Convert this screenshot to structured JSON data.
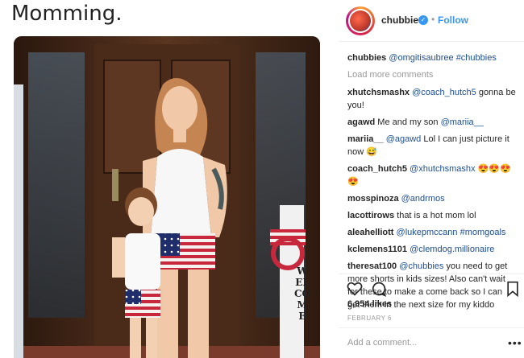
{
  "page": {
    "heading": "Momming."
  },
  "post": {
    "username": "chubbies",
    "follow_label": "Follow",
    "dot": "•",
    "load_more": "Load more comments",
    "comments": [
      {
        "user": "chubbies",
        "parts": [
          {
            "t": "mention",
            "v": "@omgitisaubree"
          },
          {
            "t": "text",
            "v": " "
          },
          {
            "t": "mention",
            "v": "#chubbies"
          }
        ]
      },
      {
        "user": "xhutchsmashx",
        "parts": [
          {
            "t": "mention",
            "v": "@coach_hutch5"
          },
          {
            "t": "text",
            "v": " gonna be you!"
          }
        ]
      },
      {
        "user": "agawd",
        "parts": [
          {
            "t": "text",
            "v": "Me and my son "
          },
          {
            "t": "mention",
            "v": "@mariia__"
          }
        ]
      },
      {
        "user": "mariia__",
        "parts": [
          {
            "t": "mention",
            "v": "@agawd"
          },
          {
            "t": "text",
            "v": " Lol I can just picture it now 😅"
          }
        ]
      },
      {
        "user": "coach_hutch5",
        "parts": [
          {
            "t": "mention",
            "v": "@xhutchsmashx"
          },
          {
            "t": "text",
            "v": " 😍😍😍😍"
          }
        ]
      },
      {
        "user": "mosspinoza",
        "parts": [
          {
            "t": "mention",
            "v": "@andrmos"
          }
        ]
      },
      {
        "user": "lacottirows",
        "parts": [
          {
            "t": "text",
            "v": "that is a hot mom lol"
          }
        ]
      },
      {
        "user": "aleahelliott",
        "parts": [
          {
            "t": "mention",
            "v": "@lukepmccann"
          },
          {
            "t": "text",
            "v": " "
          },
          {
            "t": "mention",
            "v": "#momgoals"
          }
        ]
      },
      {
        "user": "kclemens1101",
        "parts": [
          {
            "t": "mention",
            "v": "@clemdog.millionaire"
          }
        ]
      },
      {
        "user": "theresat100",
        "parts": [
          {
            "t": "mention",
            "v": "@chubbies"
          },
          {
            "t": "text",
            "v": " you need to get more shorts in kids sizes! Also can't wait for these to make a come back so I can get them in the next size for my kiddo"
          }
        ]
      }
    ],
    "likes": "6,954 likes",
    "date": "FEBRUARY 6",
    "add_comment_placeholder": "Add a comment...",
    "more": "•••"
  },
  "photo": {
    "sign_text": "WELCOME"
  },
  "colors": {
    "link": "#3897f0",
    "mention": "#1d4f91",
    "verified": "#3897f0"
  },
  "icons": [
    "heart-icon",
    "comment-icon",
    "bookmark-icon",
    "more-icon",
    "verified-icon"
  ]
}
